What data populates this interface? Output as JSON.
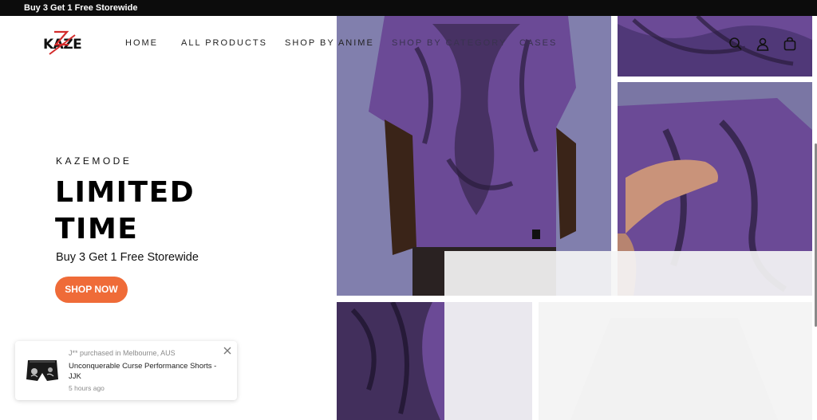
{
  "announcement": {
    "text": "Buy 3 Get 1 Free Storewide"
  },
  "header": {
    "logo_text": "KAZE",
    "nav": [
      {
        "label": "HOME"
      },
      {
        "label": "ALL PRODUCTS"
      },
      {
        "label": "SHOP BY ANIME"
      },
      {
        "label": "SHOP BY CATEGORY"
      },
      {
        "label": "CASES"
      }
    ],
    "icons": [
      "search-icon",
      "account-icon",
      "cart-icon"
    ]
  },
  "hero": {
    "eyebrow": "KAZEMODE",
    "headline_line1": "LIMITED",
    "headline_line2": "TIME",
    "subline": "Buy 3 Get 1 Free Storewide",
    "cta_label": "SHOP NOW"
  },
  "toast": {
    "who": "J** purchased in Melbourne, AUS",
    "product": "Unconquerable Curse Performance Shorts - JJK",
    "time": "5 hours ago"
  },
  "colors": {
    "accent": "#ef6b38",
    "announcement_bg": "#0c0c0c",
    "shirt_purple": "#6b4a96",
    "logo_red": "#d32b2b"
  }
}
